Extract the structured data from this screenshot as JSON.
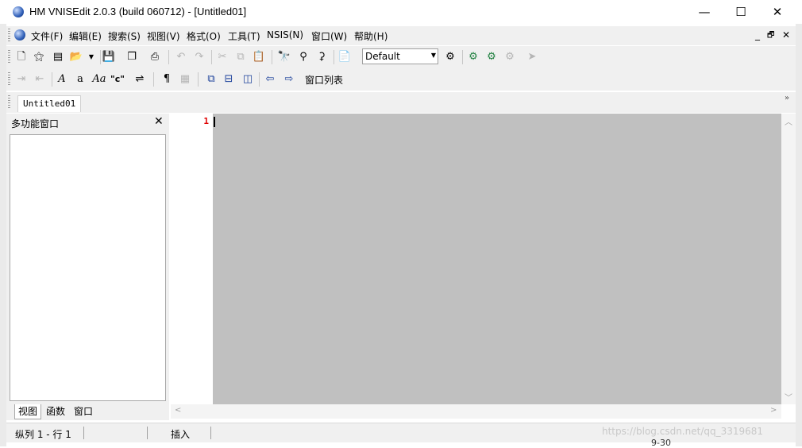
{
  "window": {
    "title": "HM VNISEdit 2.0.3 (build 060712) - [Untitled01]",
    "minimize": "—",
    "maximize": "☐",
    "close": "✕"
  },
  "menu": {
    "items": [
      "文件(F)",
      "编辑(E)",
      "搜索(S)",
      "视图(V)",
      "格式(O)",
      "工具(T)",
      "NSIS(N)",
      "窗口(W)",
      "帮助(H)"
    ],
    "mdi_min": "_",
    "mdi_restore": "🗗",
    "mdi_close": "✕"
  },
  "toolbar1": {
    "style_combo": "Default"
  },
  "toolbar2": {
    "quote_label": "\"c\"",
    "window_list_button": "窗口列表"
  },
  "document_tab": "Untitled01",
  "side_panel": {
    "title": "多功能窗口",
    "tabs": [
      "视图",
      "函数",
      "窗口"
    ]
  },
  "editor": {
    "line_numbers": [
      "1"
    ]
  },
  "status": {
    "position": "纵列 1 - 行 1",
    "mode": "插入"
  },
  "background": {
    "watermark": "https://blog.csdn.net/qq_3319681",
    "folder_label": "9-30"
  }
}
